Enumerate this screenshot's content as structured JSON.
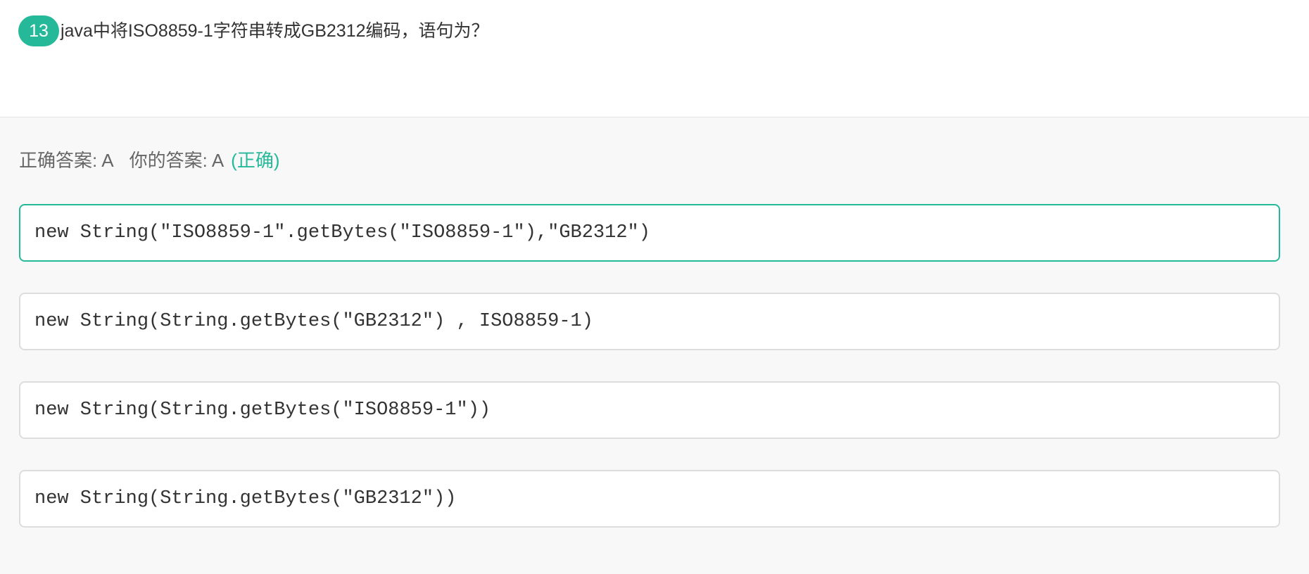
{
  "question": {
    "number": "13",
    "text": "java中将ISO8859-1字符串转成GB2312编码，语句为？"
  },
  "answer": {
    "correct_label": "正确答案:",
    "correct_value": "A",
    "your_label": "你的答案:",
    "your_value": "A",
    "status": "(正确)"
  },
  "options": [
    {
      "text": "new String(\"ISO8859-1\".getBytes(\"ISO8859-1\"),\"GB2312\")",
      "selected": true
    },
    {
      "text": "new String(String.getBytes(\"GB2312\") , ISO8859-1)",
      "selected": false
    },
    {
      "text": "new String(String.getBytes(\"ISO8859-1\"))",
      "selected": false
    },
    {
      "text": "new String(String.getBytes(\"GB2312\"))",
      "selected": false
    }
  ],
  "colors": {
    "accent": "#25b99a",
    "border": "#dddddd",
    "panel_background": "#f8f8f8"
  }
}
